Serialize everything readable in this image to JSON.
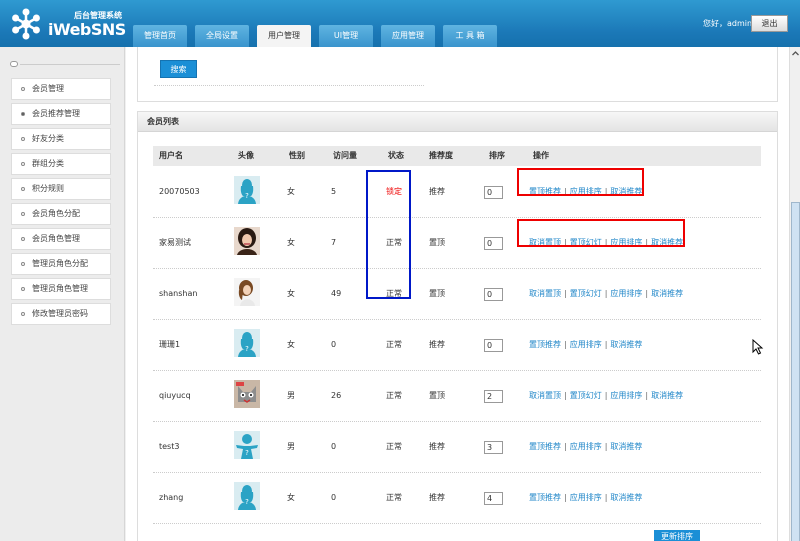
{
  "header": {
    "subtitle": "后台管理系统",
    "brand": "iWebSNS",
    "greeting": "您好，admin",
    "logout_label": "退出",
    "nav_tabs": [
      {
        "label": "管理首页",
        "active": false
      },
      {
        "label": "全局设置",
        "active": false
      },
      {
        "label": "用户管理",
        "active": true
      },
      {
        "label": "UI管理",
        "active": false
      },
      {
        "label": "应用管理",
        "active": false
      },
      {
        "label": "工 具 箱",
        "active": false
      }
    ]
  },
  "sidebar": {
    "items": [
      {
        "label": "会员管理",
        "active": false
      },
      {
        "label": "会员推荐管理",
        "active": true
      },
      {
        "label": "好友分类",
        "active": false
      },
      {
        "label": "群组分类",
        "active": false
      },
      {
        "label": "积分规则",
        "active": false
      },
      {
        "label": "会员角色分配",
        "active": false
      },
      {
        "label": "会员角色管理",
        "active": false
      },
      {
        "label": "管理员角色分配",
        "active": false
      },
      {
        "label": "管理员角色管理",
        "active": false
      },
      {
        "label": "修改管理员密码",
        "active": false
      }
    ]
  },
  "search": {
    "button_label": "搜索"
  },
  "list": {
    "title": "会员列表",
    "columns": [
      "用户名",
      "头像",
      "性别",
      "访问量",
      "状态",
      "推荐度",
      "排序",
      "操作"
    ],
    "rows": [
      {
        "username": "20070503",
        "gender": "女",
        "visits": "5",
        "status": "锁定",
        "status_red": true,
        "recommend": "推荐",
        "sort": "0",
        "avatar": "placeholder-female",
        "actions": [
          "置顶推荐",
          "应用排序",
          "取消推荐"
        ]
      },
      {
        "username": "家易测试",
        "gender": "女",
        "visits": "7",
        "status": "正常",
        "status_red": false,
        "recommend": "置顶",
        "sort": "0",
        "avatar": "photo-girl",
        "actions": [
          "取消置顶",
          "置顶幻灯",
          "应用排序",
          "取消推荐"
        ]
      },
      {
        "username": "shanshan",
        "gender": "女",
        "visits": "49",
        "status": "正常",
        "status_red": false,
        "recommend": "置顶",
        "sort": "0",
        "avatar": "photo-woman",
        "actions": [
          "取消置顶",
          "置顶幻灯",
          "应用排序",
          "取消推荐"
        ]
      },
      {
        "username": "珊珊1",
        "gender": "女",
        "visits": "0",
        "status": "正常",
        "status_red": false,
        "recommend": "推荐",
        "sort": "0",
        "avatar": "placeholder-female",
        "actions": [
          "置顶推荐",
          "应用排序",
          "取消推荐"
        ]
      },
      {
        "username": "qiuyucq",
        "gender": "男",
        "visits": "26",
        "status": "正常",
        "status_red": false,
        "recommend": "置顶",
        "sort": "2",
        "avatar": "photo-cat",
        "actions": [
          "取消置顶",
          "置顶幻灯",
          "应用排序",
          "取消推荐"
        ]
      },
      {
        "username": "test3",
        "gender": "男",
        "visits": "0",
        "status": "正常",
        "status_red": false,
        "recommend": "推荐",
        "sort": "3",
        "avatar": "placeholder-male",
        "actions": [
          "置顶推荐",
          "应用排序",
          "取消推荐"
        ]
      },
      {
        "username": "zhang",
        "gender": "女",
        "visits": "0",
        "status": "正常",
        "status_red": false,
        "recommend": "推荐",
        "sort": "4",
        "avatar": "placeholder-female",
        "actions": [
          "置顶推荐",
          "应用排序",
          "取消推荐"
        ]
      }
    ],
    "update_sort_label": "更新排序"
  },
  "colors": {
    "header_blue": "#1b78b7",
    "link": "#1f86c8",
    "highlight_red": "#ee0000",
    "highlight_blue": "#0018c8"
  }
}
